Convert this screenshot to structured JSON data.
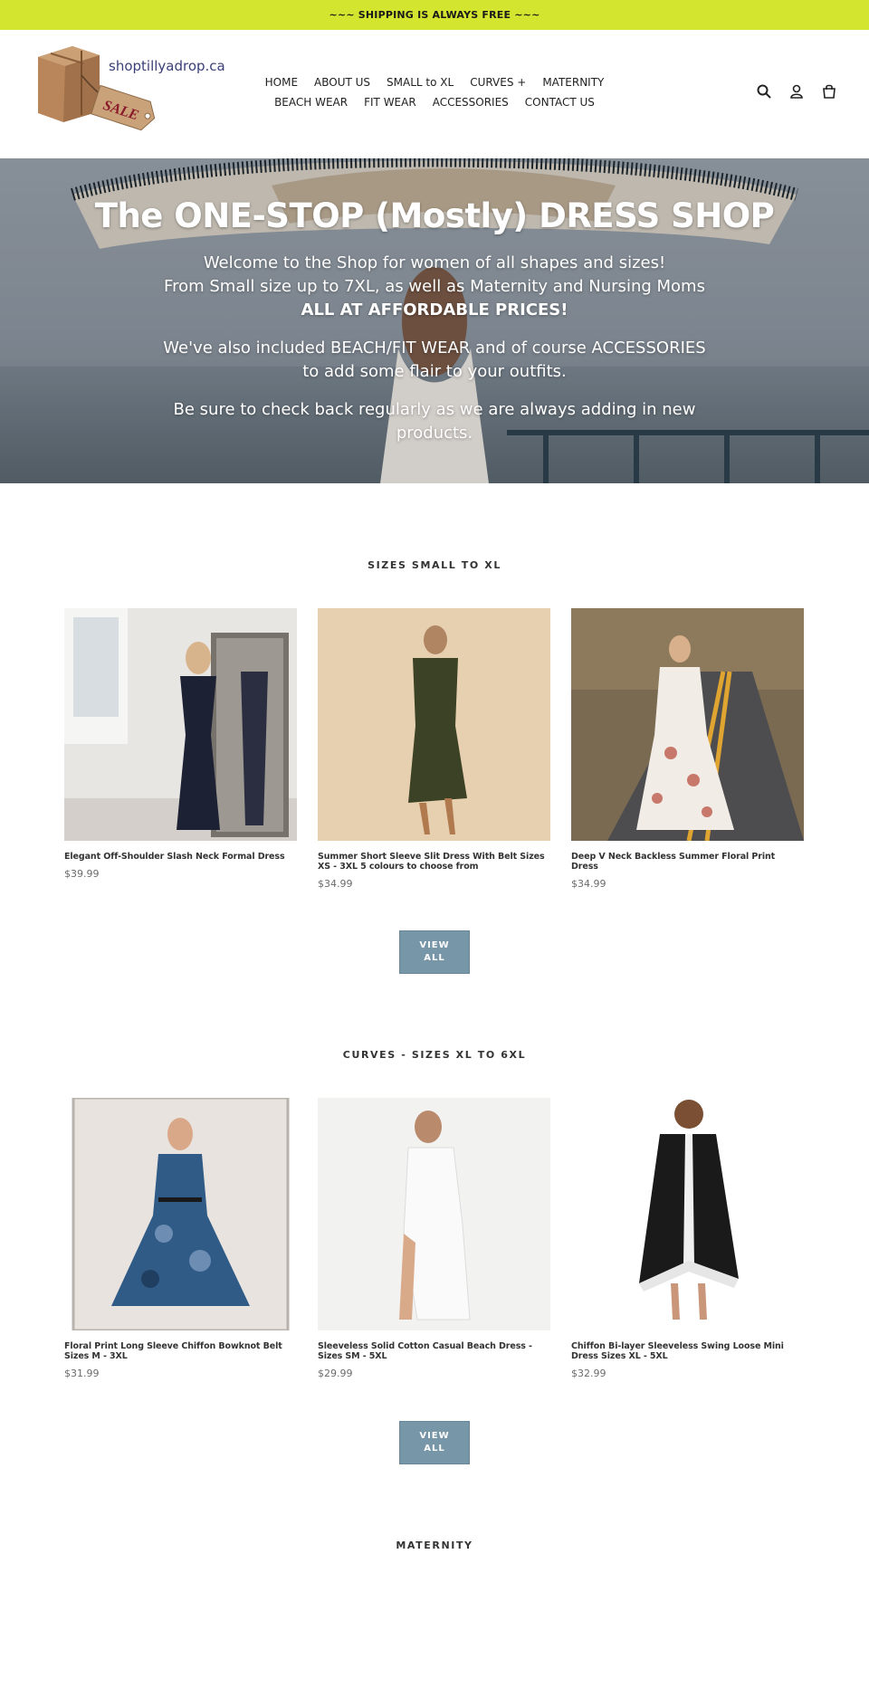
{
  "announcement": "~~~ SHIPPING IS ALWAYS FREE ~~~",
  "logo": {
    "text": "shoptillyadrop.ca",
    "tag_text": "SALE"
  },
  "nav": {
    "row1": [
      "HOME",
      "ABOUT US",
      "SMALL to XL",
      "CURVES +",
      "MATERNITY"
    ],
    "row2": [
      "BEACH WEAR",
      "FIT WEAR",
      "ACCESSORIES",
      "CONTACT US"
    ]
  },
  "header_icons": [
    "search-icon",
    "account-icon",
    "cart-icon"
  ],
  "hero": {
    "title": "The ONE-STOP (Mostly) DRESS SHOP",
    "line1": "Welcome to the Shop for women of all shapes and sizes!",
    "line2": "From Small size up to 7XL, as well as Maternity and Nursing Moms",
    "line3": "ALL AT AFFORDABLE PRICES!",
    "para2": "We've also included BEACH/FIT WEAR and of course ACCESSORIES to add some flair to your outfits.",
    "para3": "Be sure to check back regularly as we are always adding in new products."
  },
  "sections": [
    {
      "title": "SIZES SMALL TO XL",
      "products": [
        {
          "name": "Elegant Off-Shoulder Slash Neck Formal Dress",
          "price": "$39.99"
        },
        {
          "name": "Summer Short Sleeve Slit Dress With Belt Sizes XS - 3XL 5 colours to choose from",
          "price": "$34.99"
        },
        {
          "name": "Deep V Neck Backless Summer Floral Print Dress",
          "price": "$34.99"
        }
      ],
      "button": {
        "line1": "VIEW",
        "line2": "ALL"
      }
    },
    {
      "title": "CURVES - SIZES XL TO 6XL",
      "products": [
        {
          "name": "Floral Print Long Sleeve Chiffon Bowknot Belt Sizes M - 3XL",
          "price": "$31.99"
        },
        {
          "name": "Sleeveless Solid Cotton Casual Beach Dress - Sizes SM - 5XL",
          "price": "$29.99"
        },
        {
          "name": "Chiffon Bi-layer Sleeveless Swing Loose Mini Dress Sizes XL - 5XL",
          "price": "$32.99"
        }
      ],
      "button": {
        "line1": "VIEW",
        "line2": "ALL"
      }
    },
    {
      "title": "MATERNITY"
    }
  ],
  "colors": {
    "announcement_bg": "#d4e52f",
    "button_bg": "#7796a8"
  }
}
